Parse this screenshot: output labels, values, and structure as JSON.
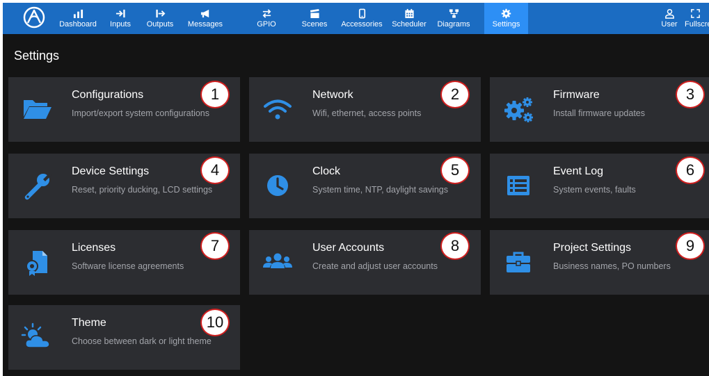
{
  "nav": {
    "logo_icon": "app-logo-icon",
    "items": [
      {
        "key": "dashboard",
        "label": "Dashboard",
        "icon": "dashboard-icon"
      },
      {
        "key": "inputs",
        "label": "Inputs",
        "icon": "inputs-icon"
      },
      {
        "key": "outputs",
        "label": "Outputs",
        "icon": "outputs-icon"
      },
      {
        "key": "messages",
        "label": "Messages",
        "icon": "megaphone-icon"
      },
      {
        "key": "gpio",
        "label": "GPIO",
        "icon": "gpio-icon"
      },
      {
        "key": "scenes",
        "label": "Scenes",
        "icon": "clapperboard-icon"
      },
      {
        "key": "accessories",
        "label": "Accessories",
        "icon": "device-icon"
      },
      {
        "key": "scheduler",
        "label": "Scheduler",
        "icon": "calendar-icon"
      },
      {
        "key": "diagrams",
        "label": "Diagrams",
        "icon": "diagram-icon"
      },
      {
        "key": "settings",
        "label": "Settings",
        "icon": "gear-icon",
        "active": true
      }
    ],
    "right": [
      {
        "key": "user",
        "label": "User",
        "icon": "user-icon"
      },
      {
        "key": "fullscreen",
        "label": "Fullscreen",
        "icon": "fullscreen-icon"
      }
    ]
  },
  "page": {
    "title": "Settings"
  },
  "cards": [
    {
      "title": "Configurations",
      "desc": "Import/export system configurations",
      "icon": "folder-icon",
      "badge": "1"
    },
    {
      "title": "Network",
      "desc": "Wifi, ethernet, access points",
      "icon": "wifi-icon",
      "badge": "2"
    },
    {
      "title": "Firmware",
      "desc": "Install firmware updates",
      "icon": "gears-icon",
      "badge": "3"
    },
    {
      "title": "Device Settings",
      "desc": "Reset, priority ducking, LCD settings",
      "icon": "wrench-icon",
      "badge": "4"
    },
    {
      "title": "Clock",
      "desc": "System time, NTP, daylight savings",
      "icon": "clock-icon",
      "badge": "5"
    },
    {
      "title": "Event Log",
      "desc": "System events, faults",
      "icon": "list-icon",
      "badge": "6"
    },
    {
      "title": "Licenses",
      "desc": "Software license agreements",
      "icon": "license-icon",
      "badge": "7"
    },
    {
      "title": "User Accounts",
      "desc": "Create and adjust user accounts",
      "icon": "users-icon",
      "badge": "8"
    },
    {
      "title": "Project Settings",
      "desc": "Business names, PO numbers",
      "icon": "briefcase-icon",
      "badge": "9"
    },
    {
      "title": "Theme",
      "desc": "Choose between dark or light theme",
      "icon": "weather-icon",
      "badge": "10"
    }
  ],
  "colors": {
    "nav_bg": "#1b6cc2",
    "nav_active": "#2d8ff5",
    "page_bg": "#141414",
    "card_bg": "#2c2d31",
    "icon_blue": "#2f8fe6",
    "desc_text": "#a3a5ab",
    "badge_border": "#d01f1f"
  }
}
